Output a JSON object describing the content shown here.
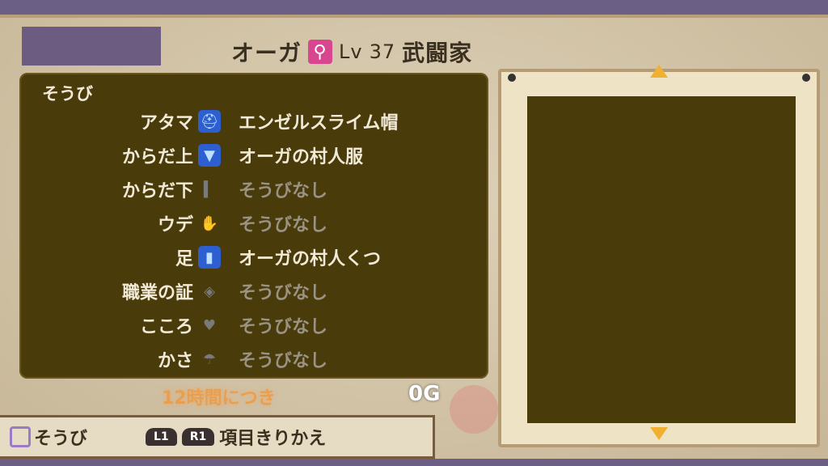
{
  "character": {
    "name": "オーガ",
    "gender_symbol": "⚲",
    "level_label": "Lv",
    "level": "37",
    "job": "武闘家"
  },
  "equipment": {
    "title": "そうび",
    "slots": [
      {
        "label": "アタマ",
        "item": "エンゼルスライム帽",
        "equipped": true,
        "icon": "helmet-icon"
      },
      {
        "label": "からだ上",
        "item": "オーガの村人服",
        "equipped": true,
        "icon": "shirt-icon"
      },
      {
        "label": "からだ下",
        "item": "そうびなし",
        "equipped": false,
        "icon": "pants-icon"
      },
      {
        "label": "ウデ",
        "item": "そうびなし",
        "equipped": false,
        "icon": "glove-icon"
      },
      {
        "label": "足",
        "item": "オーガの村人くつ",
        "equipped": true,
        "icon": "boot-icon"
      },
      {
        "label": "職業の証",
        "item": "そうびなし",
        "equipped": false,
        "icon": "emblem-icon"
      },
      {
        "label": "こころ",
        "item": "そうびなし",
        "equipped": false,
        "icon": "heart-icon"
      },
      {
        "label": "かさ",
        "item": "そうびなし",
        "equipped": false,
        "icon": "umbrella-icon"
      }
    ]
  },
  "rental": {
    "text": "12時間につき"
  },
  "gold": {
    "value": "0G"
  },
  "footer": {
    "equip_label": "そうび",
    "l1": "L1",
    "r1": "R1",
    "switch_label": "項目きりかえ"
  },
  "colors": {
    "panel": "#4a3b0b",
    "parchment": "#d9cbae",
    "equipped_icon": "#2d5fd0",
    "arrow": "#f0b030"
  }
}
